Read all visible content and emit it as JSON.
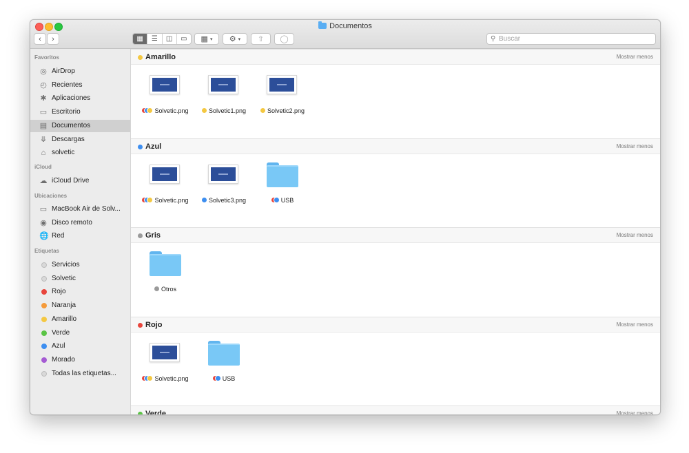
{
  "window": {
    "title": "Documentos"
  },
  "toolbar": {
    "back_icon": "chevron-left-icon",
    "forward_icon": "chevron-right-icon",
    "view_icons": [
      "grid-icon",
      "list-icon",
      "columns-icon",
      "gallery-icon"
    ],
    "group_icon": "group-by-icon",
    "action_icon": "gear-icon",
    "share_icon": "share-icon",
    "tag_icon": "tag-icon",
    "search_placeholder": "Buscar"
  },
  "sidebar": {
    "sections": [
      {
        "title": "Favoritos",
        "items": [
          {
            "label": "AirDrop",
            "icon": "airdrop-icon"
          },
          {
            "label": "Recientes",
            "icon": "clock-icon"
          },
          {
            "label": "Aplicaciones",
            "icon": "applications-icon"
          },
          {
            "label": "Escritorio",
            "icon": "desktop-icon"
          },
          {
            "label": "Documentos",
            "icon": "document-icon",
            "selected": true
          },
          {
            "label": "Descargas",
            "icon": "download-icon"
          },
          {
            "label": "solvetic",
            "icon": "home-icon"
          }
        ]
      },
      {
        "title": "iCloud",
        "items": [
          {
            "label": "iCloud Drive",
            "icon": "cloud-icon"
          }
        ]
      },
      {
        "title": "Ubicaciones",
        "items": [
          {
            "label": "MacBook Air de Solv...",
            "icon": "laptop-icon"
          },
          {
            "label": "Disco remoto",
            "icon": "disc-icon"
          },
          {
            "label": "Red",
            "icon": "network-icon"
          }
        ]
      },
      {
        "title": "Etiquetas",
        "items": [
          {
            "label": "Servicios",
            "color": "#d9d9d9"
          },
          {
            "label": "Solvetic",
            "color": "#d9d9d9"
          },
          {
            "label": "Rojo",
            "color": "#e8453c"
          },
          {
            "label": "Naranja",
            "color": "#f59a3a"
          },
          {
            "label": "Amarillo",
            "color": "#f4c842"
          },
          {
            "label": "Verde",
            "color": "#5ac445"
          },
          {
            "label": "Azul",
            "color": "#3d8ef0"
          },
          {
            "label": "Morado",
            "color": "#a55bd3"
          },
          {
            "label": "Todas las etiquetas...",
            "color": "#d9d9d9"
          }
        ]
      }
    ]
  },
  "content": {
    "collapse_label": "Mostrar menos",
    "groups": [
      {
        "title": "Amarillo",
        "color": "#f4c842",
        "files": [
          {
            "name": "Solvetic.png",
            "kind": "image",
            "tags": [
              "#e8453c",
              "#3d8ef0",
              "#f4c842"
            ]
          },
          {
            "name": "Solvetic1.png",
            "kind": "image",
            "tags": [
              "#f4c842"
            ]
          },
          {
            "name": "Solvetic2.png",
            "kind": "image",
            "tags": [
              "#f4c842"
            ]
          }
        ]
      },
      {
        "title": "Azul",
        "color": "#3d8ef0",
        "files": [
          {
            "name": "Solvetic.png",
            "kind": "image",
            "tags": [
              "#e8453c",
              "#3d8ef0",
              "#f4c842"
            ]
          },
          {
            "name": "Solvetic3.png",
            "kind": "image",
            "tags": [
              "#3d8ef0"
            ]
          },
          {
            "name": "USB",
            "kind": "folder",
            "tags": [
              "#e8453c",
              "#3d8ef0"
            ]
          }
        ]
      },
      {
        "title": "Gris",
        "color": "#9a9a9a",
        "files": [
          {
            "name": "Otros",
            "kind": "folder",
            "tags": [
              "#9a9a9a"
            ]
          }
        ]
      },
      {
        "title": "Rojo",
        "color": "#e8453c",
        "files": [
          {
            "name": "Solvetic.png",
            "kind": "image",
            "tags": [
              "#e8453c",
              "#3d8ef0",
              "#f4c842"
            ]
          },
          {
            "name": "USB",
            "kind": "folder",
            "tags": [
              "#e8453c",
              "#3d8ef0"
            ]
          }
        ]
      },
      {
        "title": "Verde",
        "color": "#5ac445",
        "files": []
      }
    ]
  }
}
